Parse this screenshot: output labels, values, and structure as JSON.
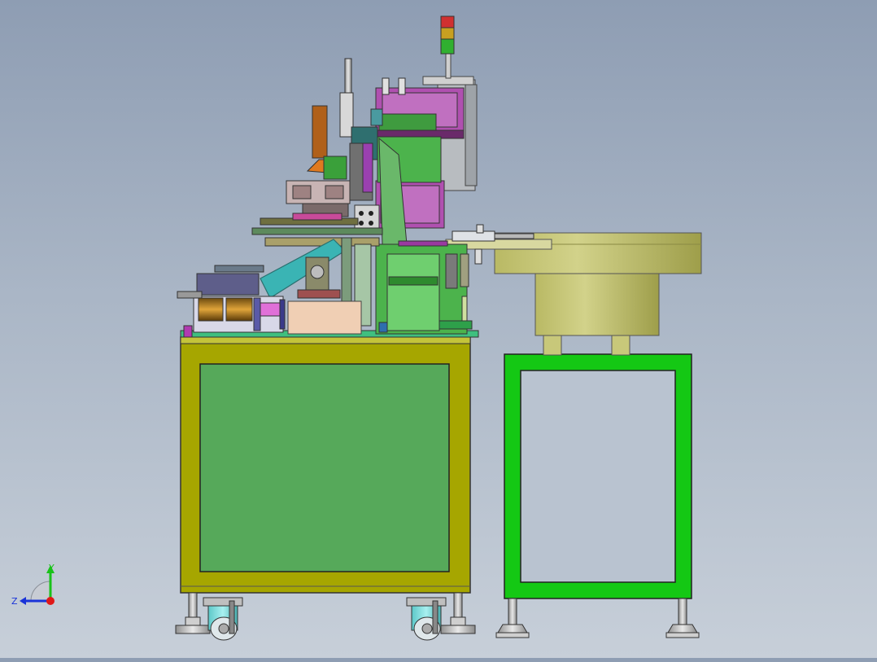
{
  "viewport": {
    "background_top": "#8e9db3",
    "background_bottom": "#c7cfd9"
  },
  "triad": {
    "y_label": "Y",
    "z_label": "Z",
    "y_color": "#19c219",
    "z_color": "#1a33d8",
    "x_color": "#e01818"
  },
  "colors": {
    "main_frame": "#a6a600",
    "main_panel": "#56a95a",
    "feeder_frame": "#14c814",
    "feeder_bowl": "#c8c87a",
    "caster": "#7fe0e0",
    "motor_magenta": "#b050b0",
    "signal_red": "#d03030",
    "signal_amber": "#c8a020",
    "signal_green": "#30b030"
  }
}
